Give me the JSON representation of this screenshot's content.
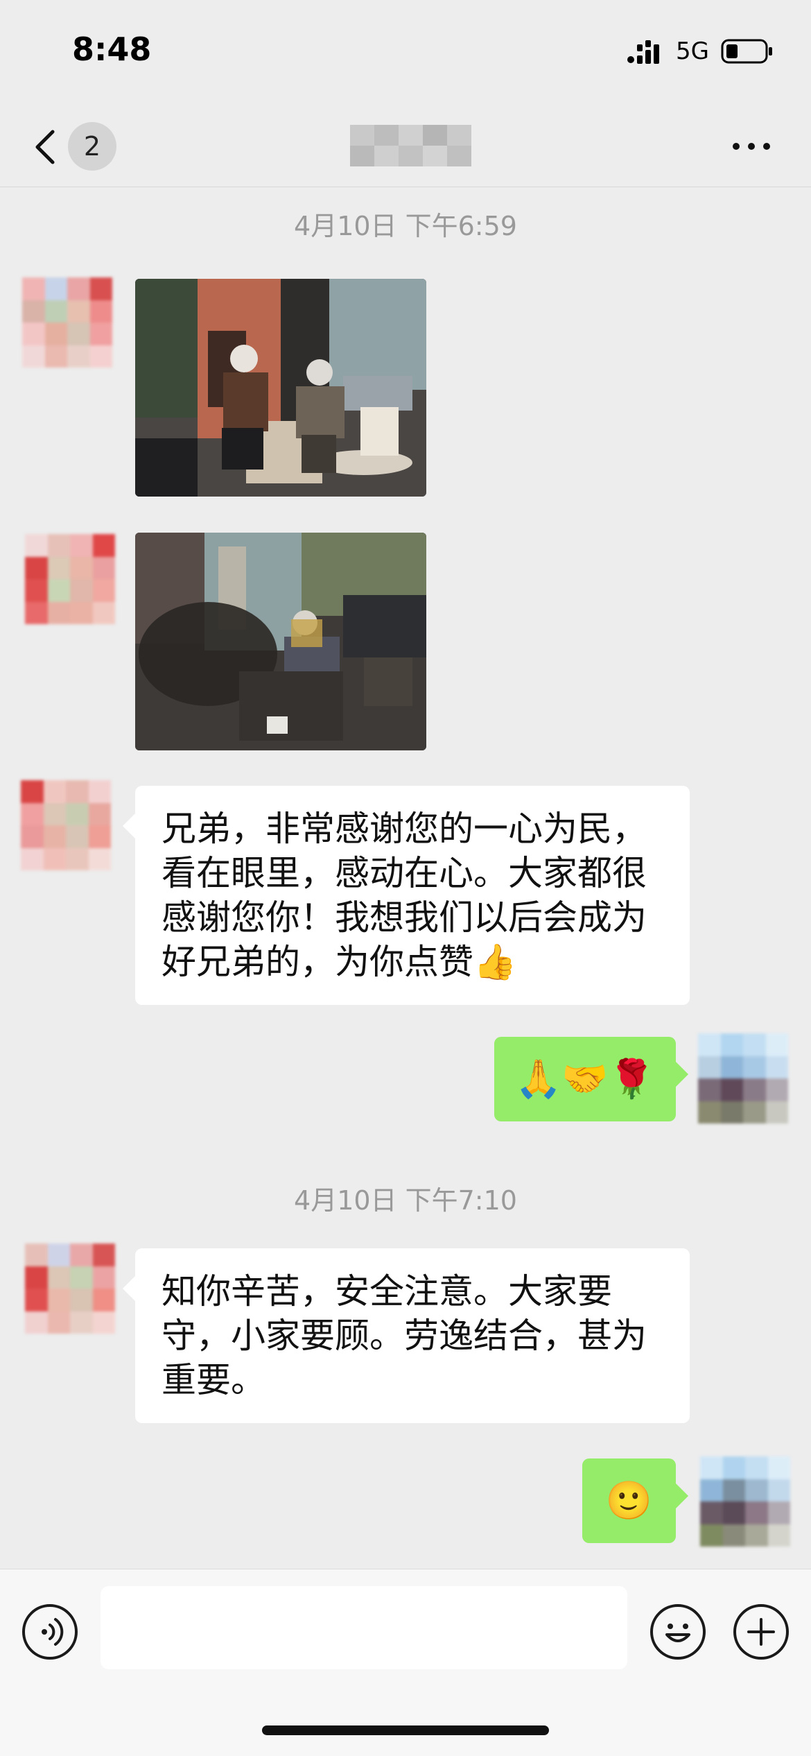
{
  "status_bar": {
    "time": "8:48",
    "network": "5G",
    "signal_icon": "signal-bars-icon",
    "battery_icon": "battery-low-icon"
  },
  "nav": {
    "back_icon": "chevron-left-icon",
    "unread_count": "2",
    "more_icon": "ellipsis-icon"
  },
  "messages": {
    "timestamp_1": "4月10日 下午6:59",
    "msg_text_1": "兄弟，非常感谢您的一心为民，看在眼里，感动在心。大家都很感谢您你！我想我们以后会成为好兄弟的，为你点赞👍",
    "msg_out_1": "🙏🤝🌹",
    "timestamp_2": "4月10日 下午7:10",
    "msg_text_2": "知你辛苦，安全注意。大家要守，小家要顾。劳逸结合，甚为重要。",
    "msg_out_2": "🙂"
  },
  "input_bar": {
    "voice_icon": "voice-icon",
    "emoji_icon": "smiley-icon",
    "plus_icon": "plus-icon"
  },
  "colors": {
    "background": "#ededed",
    "outgoing_bubble": "#95ec69",
    "incoming_bubble": "#ffffff",
    "timestamp": "#999999"
  }
}
